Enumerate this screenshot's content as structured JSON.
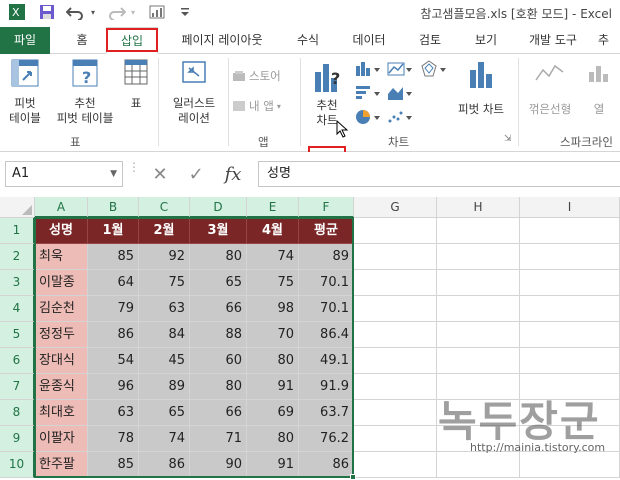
{
  "window": {
    "title": "참고샘플모음.xls [호환 모드] - Excel"
  },
  "tabs": [
    {
      "label": "파일"
    },
    {
      "label": "홈"
    },
    {
      "label": "삽입"
    },
    {
      "label": "페이지 레이아웃"
    },
    {
      "label": "수식"
    },
    {
      "label": "데이터"
    },
    {
      "label": "검토"
    },
    {
      "label": "보기"
    },
    {
      "label": "개발 도구"
    },
    {
      "label": "추"
    }
  ],
  "ribbon": {
    "pivot_table": {
      "line1": "피벗",
      "line2": "테이블"
    },
    "recommended_pivot": {
      "line1": "추천",
      "line2": "피벗 테이블"
    },
    "table": {
      "label": "표"
    },
    "group_table": "표",
    "illustrations": {
      "line1": "일러스트",
      "line2": "레이션"
    },
    "store": "스토어",
    "my_apps": "내 앱",
    "group_apps": "앱",
    "recommended_charts": {
      "line1": "추천",
      "line2": "차트"
    },
    "pivot_chart": "피벗 차트",
    "group_charts": "차트",
    "line_sparkline": "꺾은선형",
    "column_sparkline": "열",
    "group_sparklines": "스파크라인"
  },
  "formula_bar": {
    "name_box": "A1",
    "content": "성명",
    "fx": "fx"
  },
  "grid": {
    "columns": [
      "A",
      "B",
      "C",
      "D",
      "E",
      "F",
      "G",
      "H",
      "I"
    ],
    "rows": [
      "1",
      "2",
      "3",
      "4",
      "5",
      "6",
      "7",
      "8",
      "9",
      "10"
    ],
    "header": [
      "성명",
      "1월",
      "2월",
      "3월",
      "4월",
      "평균"
    ],
    "data": [
      [
        "최욱",
        "85",
        "92",
        "80",
        "74",
        "89"
      ],
      [
        "이말종",
        "64",
        "75",
        "65",
        "75",
        "70.1"
      ],
      [
        "김순천",
        "79",
        "63",
        "66",
        "98",
        "70.1"
      ],
      [
        "정정두",
        "86",
        "84",
        "88",
        "70",
        "86.4"
      ],
      [
        "장대식",
        "54",
        "45",
        "60",
        "80",
        "49.1"
      ],
      [
        "윤종식",
        "96",
        "89",
        "80",
        "91",
        "91.9"
      ],
      [
        "최대호",
        "63",
        "65",
        "66",
        "69",
        "63.7"
      ],
      [
        "이팔자",
        "78",
        "74",
        "71",
        "80",
        "76.2"
      ],
      [
        "한주팔",
        "85",
        "86",
        "90",
        "91",
        "86"
      ]
    ]
  },
  "watermark": {
    "text": "녹두장군",
    "url": "http://mainia.tistory.com"
  },
  "colors": {
    "excel_green": "#217346",
    "header_fill": "#7a2626",
    "name_fill": "#eebcb6",
    "value_fill": "#c9c9c9",
    "highlight": "#e02020"
  }
}
